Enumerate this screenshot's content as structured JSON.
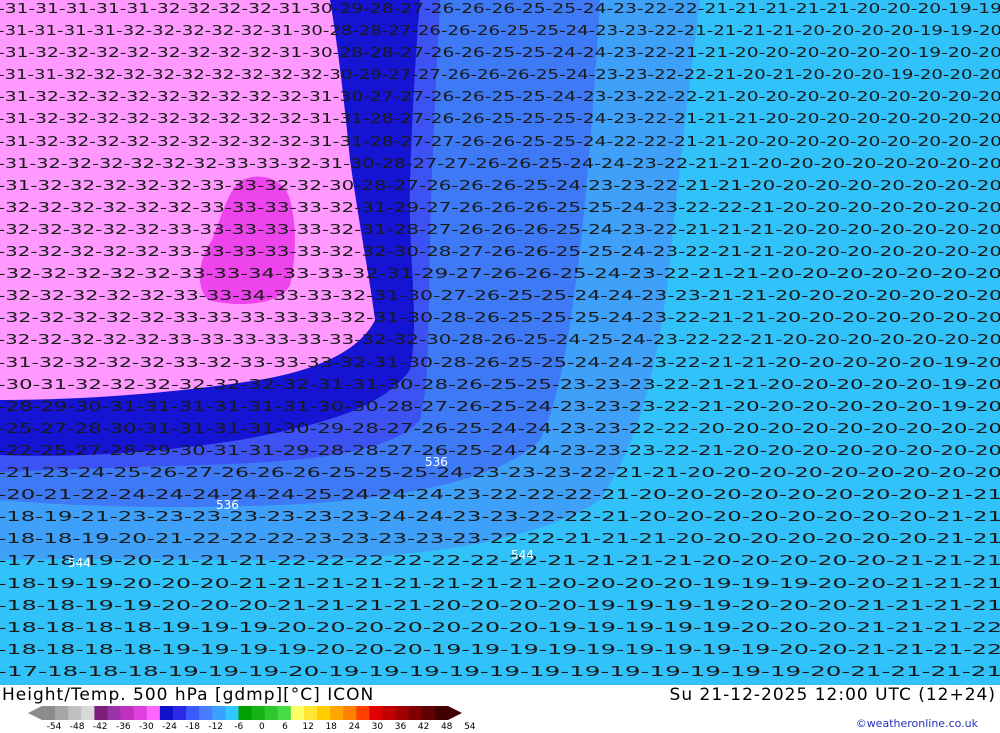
{
  "title": "Height/Temp. 500 hPa [gdmp][°C] ICON",
  "valid_time": "Su 21-12-2025 12:00 UTC (12+24)",
  "credit": "©weatheronline.co.uk",
  "legend": {
    "ticks": [
      "-54",
      "-48",
      "-42",
      "-36",
      "-30",
      "-24",
      "-18",
      "-12",
      "-6",
      "0",
      "6",
      "12",
      "18",
      "24",
      "30",
      "36",
      "42",
      "48",
      "54"
    ],
    "colors": [
      "#8c8c8c",
      "#a6a6a6",
      "#c0c0c0",
      "#d9d9d9",
      "#7a1f7a",
      "#9933aa",
      "#c030c0",
      "#e040e0",
      "#ff66ff",
      "#1010c8",
      "#2a2ae6",
      "#3c5aff",
      "#4a7cff",
      "#3ca0ff",
      "#30c8ff",
      "#00a000",
      "#14b414",
      "#2ec82e",
      "#46dc46",
      "#ffff66",
      "#ffe633",
      "#ffcc00",
      "#ffa500",
      "#ff7f00",
      "#ff4000",
      "#e00000",
      "#c00000",
      "#a00000",
      "#800000",
      "#600000",
      "#400000"
    ]
  },
  "map": {
    "zone_colors": {
      "pink": "#ff99ff",
      "magenta": "#ee44ee",
      "deep_blue": "#1414d2",
      "blue": "#3c52f2",
      "mid_blue": "#3e7af6",
      "light_blue": "#3ea0f8",
      "cyan": "#32c2fa",
      "aqua": "#36e0fc"
    },
    "geopotential_labels": [
      "536",
      "536",
      "544",
      "544"
    ],
    "temperature_rows": [
      "-31-31-31-31-31-32-32-32-32-31-30-29-28-27-26-26-26-25-25-24-23-22-22-21-21-21-21-21-20-20-20-19-19",
      "-31-31-31-31-32-32-32-32-32-31-30-28-28-27-26-26-26-25-25-24-23-23-22-21-21-21-21-20-20-20-20-19-19-20",
      "-31-32-32-32-32-32-32-32-32-31-30-28-28-27-26-26-25-25-24-24-23-22-21-21-20-20-20-20-20-20-19-20-20",
      "-31-31-32-32-32-32-32-32-32-32-32-30-29-27-27-26-26-26-25-24-23-23-22-22-21-20-21-20-20-20-19-20-20-20",
      "-31-32-32-32-32-32-32-32-32-32-31-30-27-27-26-26-25-25-24-23-23-22-22-21-20-20-20-20-20-20-20-20-20",
      "-31-32-32-32-32-32-32-32-32-32-31-31-28-27-26-26-25-25-25-24-23-22-21-21-21-20-20-20-20-20-20-20-20",
      "-31-32-32-32-32-32-32-32-32-32-31-31-28-27-27-26-26-25-25-24-22-22-21-21-20-20-20-20-20-20-20-20-20",
      "-31-32-32-32-32-32-32-33-33-32-31-30-28-27-27-26-26-25-24-24-23-22-21-21-20-20-20-20-20-20-20-20",
      "-31-32-32-32-32-32-33-33-32-32-30-28-27-26-26-26-25-24-23-23-22-21-21-20-20-20-20-20-20-20-20",
      "-32-32-32-32-32-32-33-33-33-33-32-31-29-27-26-26-26-25-25-24-23-22-22-21-20-20-20-20-20-20-20",
      "-32-32-32-32-32-33-33-33-33-33-32-31-28-27-26-26-26-25-24-23-22-21-21-21-20-20-20-20-20-20-20",
      "-32-32-32-32-32-33-33-33-33-33-32-32-30-28-27-26-26-25-25-24-23-22-21-21-20-20-20-20-20-20-20",
      "-32-32-32-32-32-33-33-34-33-33-32-31-29-27-26-26-25-24-23-22-21-21-20-20-20-20-20-20-20",
      "-32-32-32-32-32-33-33-34-33-33-32-31-30-27-26-25-25-24-24-23-23-21-21-20-20-20-20-20-20-20",
      "-32-32-32-32-32-33-33-33-33-33-32-31-30-28-26-25-25-25-24-23-22-21-21-20-20-20-20-20-20-20",
      "-32-32-32-32-32-33-33-33-33-33-33-32-32-30-28-26-25-24-25-24-23-22-22-21-20-20-20-20-20-20-20",
      "-31-32-32-32-32-33-32-33-33-33-32-31-30-28-26-25-25-24-24-23-22-21-21-20-20-20-20-20-19-20",
      "-30-31-32-32-32-32-32-32-32-31-31-30-28-26-25-25-23-23-23-22-21-21-20-20-20-20-20-19-20",
      "-28-29-30-31-31-31-31-31-31-30-30-28-27-26-25-24-23-23-23-22-21-20-20-20-20-20-20-19-20",
      "-25-27-28-30-31-31-31-31-30-29-28-27-26-25-24-24-23-23-22-22-20-20-20-20-20-20-20-20-20",
      "-22-25-27-28-29-30-31-31-29-28-28-27-26-25-24-24-23-23-23-22-21-20-20-20-20-20-20-20-20",
      "-21-23-24-25-26-27-26-26-26-25-25-25-24-23-23-23-22-21-21-20-20-20-20-20-20-20-20-20",
      "-20-21-22-24-24-24-24-24-25-24-24-24-23-22-22-22-21-20-20-20-20-20-20-20-20-21-21",
      "-18-19-21-23-23-23-23-23-23-23-24-24-23-23-22-22-21-20-20-20-20-20-20-20-20-21-21",
      "-18-18-19-20-21-22-22-22-23-23-23-23-23-22-22-21-21-21-20-20-20-20-20-20-20-21-21",
      "-17-18-19-20-21-21-21-22-22-22-22-22-22-22-21-21-21-21-20-20-20-20-20-21-21-21",
      "-18-19-19-20-20-20-21-21-21-21-21-21-21-21-20-20-20-20-19-19-19-20-20-21-21-21",
      "-18-18-19-19-20-20-20-21-21-21-21-20-20-20-20-19-19-19-19-20-20-20-21-21-21-21",
      "-18-18-18-18-19-19-19-20-20-20-20-20-20-20-19-19-19-19-19-20-20-20-21-21-21-22",
      "-18-18-18-18-19-19-19-19-20-20-20-19-19-19-19-19-19-19-19-19-20-20-21-21-21-22",
      "-17-18-18-18-19-19-19-20-19-19-19-19-19-19-19-19-19-19-19-19-20-21-21-21-21"
    ]
  }
}
